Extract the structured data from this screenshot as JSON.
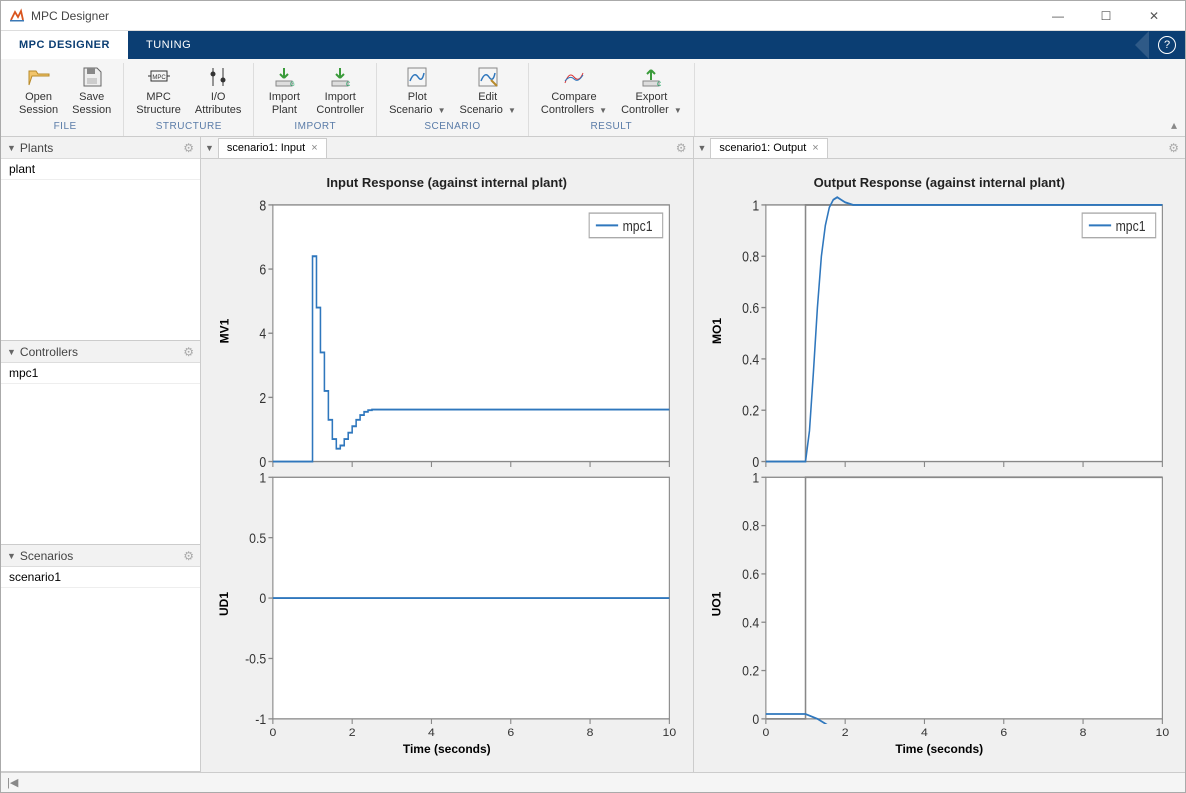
{
  "window": {
    "title": "MPC Designer"
  },
  "tabs": {
    "designer": "MPC DESIGNER",
    "tuning": "TUNING"
  },
  "ribbon": {
    "file": {
      "title": "FILE",
      "open": "Open\nSession",
      "save": "Save\nSession"
    },
    "structure": {
      "title": "STRUCTURE",
      "mpc": "MPC\nStructure",
      "io": "I/O\nAttributes"
    },
    "import": {
      "title": "IMPORT",
      "plant": "Import\nPlant",
      "controller": "Import\nController"
    },
    "scenario": {
      "title": "SCENARIO",
      "plot": "Plot\nScenario",
      "edit": "Edit\nScenario"
    },
    "result": {
      "title": "RESULT",
      "compare": "Compare\nControllers",
      "export": "Export\nController"
    }
  },
  "sidebar": {
    "plants": {
      "title": "Plants",
      "items": [
        "plant"
      ]
    },
    "controllers": {
      "title": "Controllers",
      "items": [
        "mpc1"
      ]
    },
    "scenarios": {
      "title": "Scenarios",
      "items": [
        "scenario1"
      ]
    }
  },
  "input_pane": {
    "tab": "scenario1: Input",
    "title": "Input Response (against internal plant)",
    "ylabel1": "MV1",
    "ylabel2": "UD1",
    "xlabel": "Time (seconds)",
    "legend": "mpc1"
  },
  "output_pane": {
    "tab": "scenario1: Output",
    "title": "Output Response (against internal plant)",
    "ylabel1": "MO1",
    "ylabel2": "UO1",
    "xlabel": "Time (seconds)",
    "legend": "mpc1"
  },
  "chart_data": [
    {
      "type": "line",
      "name": "MV1",
      "xlabel": "Time (seconds)",
      "ylabel": "MV1",
      "xlim": [
        0,
        10
      ],
      "ylim": [
        0,
        8
      ],
      "yticks": [
        0,
        2,
        4,
        6,
        8
      ],
      "xticks": [
        0,
        2,
        4,
        6,
        8,
        10
      ],
      "series": [
        {
          "name": "mpc1",
          "color": "#2f77bd",
          "x": [
            0,
            1.0,
            1.0,
            1.1,
            1.1,
            1.2,
            1.2,
            1.3,
            1.3,
            1.4,
            1.4,
            1.5,
            1.5,
            1.6,
            1.6,
            1.7,
            1.7,
            1.8,
            1.8,
            1.9,
            1.9,
            2.0,
            2.0,
            2.1,
            2.1,
            2.2,
            2.2,
            2.3,
            2.3,
            2.4,
            2.4,
            2.5,
            2.5,
            10
          ],
          "y": [
            0,
            0,
            6.4,
            6.4,
            4.8,
            4.8,
            3.4,
            3.4,
            2.2,
            2.2,
            1.3,
            1.3,
            0.7,
            0.7,
            0.4,
            0.4,
            0.5,
            0.5,
            0.7,
            0.7,
            0.9,
            0.9,
            1.1,
            1.1,
            1.3,
            1.3,
            1.45,
            1.45,
            1.55,
            1.55,
            1.6,
            1.6,
            1.62,
            1.62
          ]
        }
      ]
    },
    {
      "type": "line",
      "name": "UD1",
      "xlabel": "Time (seconds)",
      "ylabel": "UD1",
      "xlim": [
        0,
        10
      ],
      "ylim": [
        -1,
        1
      ],
      "yticks": [
        -1,
        -0.5,
        0,
        0.5,
        1
      ],
      "xticks": [
        0,
        2,
        4,
        6,
        8,
        10
      ],
      "series": [
        {
          "name": "mpc1",
          "color": "#2f77bd",
          "x": [
            0,
            10
          ],
          "y": [
            0,
            0
          ]
        }
      ]
    },
    {
      "type": "line",
      "name": "MO1",
      "xlabel": "Time (seconds)",
      "ylabel": "MO1",
      "xlim": [
        0,
        10
      ],
      "ylim": [
        0,
        1
      ],
      "yticks": [
        0,
        0.2,
        0.4,
        0.6,
        0.8,
        1
      ],
      "xticks": [
        0,
        2,
        4,
        6,
        8,
        10
      ],
      "series": [
        {
          "name": "ref",
          "color": "#888",
          "x": [
            0,
            1,
            1,
            10
          ],
          "y": [
            0,
            0,
            1,
            1
          ]
        },
        {
          "name": "mpc1",
          "color": "#2f77bd",
          "x": [
            0,
            1.0,
            1.1,
            1.2,
            1.3,
            1.4,
            1.5,
            1.6,
            1.7,
            1.8,
            1.9,
            2.0,
            2.2,
            2.5,
            3.0,
            10
          ],
          "y": [
            0,
            0,
            0.12,
            0.35,
            0.6,
            0.8,
            0.92,
            0.99,
            1.02,
            1.03,
            1.02,
            1.01,
            1.0,
            1.0,
            1.0,
            1.0
          ]
        }
      ]
    },
    {
      "type": "line",
      "name": "UO1",
      "xlabel": "Time (seconds)",
      "ylabel": "UO1",
      "xlim": [
        0,
        10
      ],
      "ylim": [
        0,
        1
      ],
      "yticks": [
        0,
        0.2,
        0.4,
        0.6,
        0.8,
        1
      ],
      "xticks": [
        0,
        2,
        4,
        6,
        8,
        10
      ],
      "series": [
        {
          "name": "ref",
          "color": "#888",
          "x": [
            0,
            1,
            1,
            10
          ],
          "y": [
            0,
            0,
            1,
            1
          ]
        },
        {
          "name": "mpc1",
          "color": "#2f77bd",
          "x": [
            0,
            1.0,
            1.3,
            1.5,
            1.8,
            2.0,
            2.5,
            10
          ],
          "y": [
            0.02,
            0.02,
            0.0,
            -0.02,
            -0.05,
            -0.06,
            -0.07,
            -0.07
          ]
        }
      ]
    }
  ]
}
